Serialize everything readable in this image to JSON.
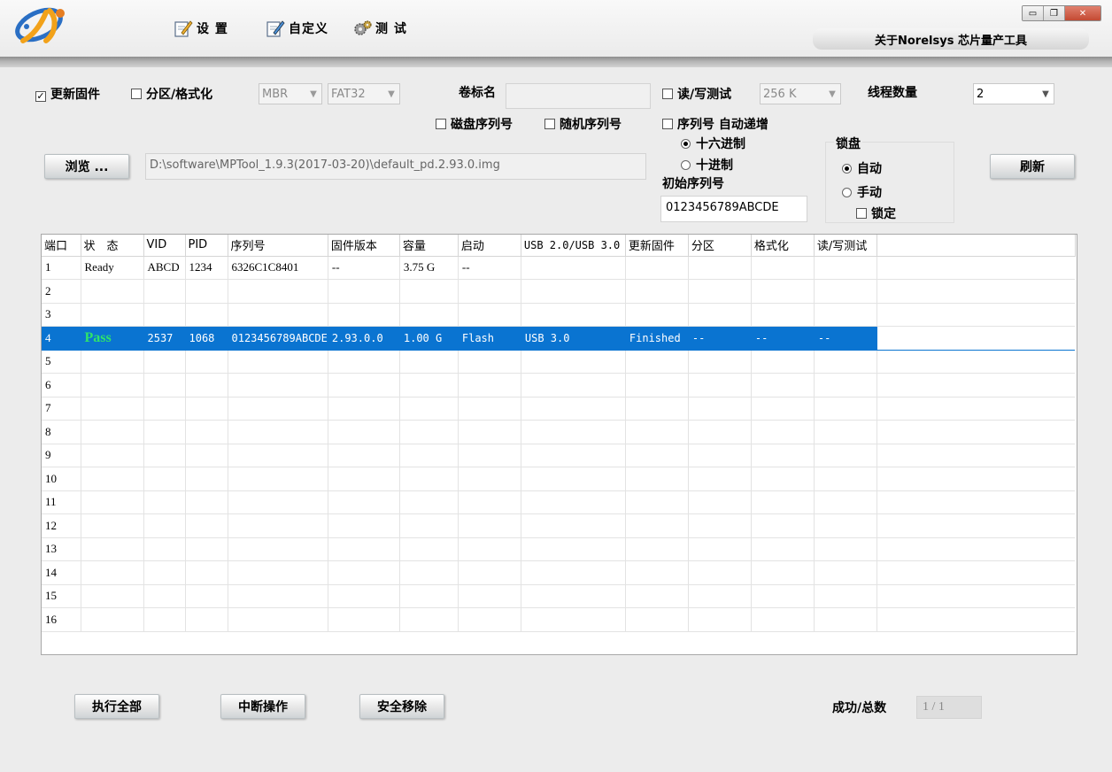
{
  "menu": {
    "settings_label": "设 置",
    "customize_label": "自定义",
    "test_label": "测 试",
    "about_label": "关于Norelsys 芯片量产工具"
  },
  "window_controls": {
    "minimize": "▭",
    "restore": "❐",
    "close": "✕"
  },
  "options": {
    "update_fw": {
      "label": "更新固件",
      "checked": true,
      "mark": "✓"
    },
    "partition_format": {
      "label": "分区/格式化",
      "checked": false
    },
    "partition_scheme": "MBR",
    "filesystem": "FAT32",
    "volume_label_caption": "卷标名",
    "volume_label_value": "",
    "rw_test": {
      "label": "读/写测试",
      "checked": false
    },
    "rw_size": "256 K",
    "thread_count_caption": "线程数量",
    "thread_count": "2",
    "disk_serial": {
      "label": "磁盘序列号",
      "checked": false
    },
    "random_serial": {
      "label": "随机序列号",
      "checked": false
    },
    "serial_auto_inc": {
      "label": "序列号 自动递增",
      "checked": false
    },
    "hex": {
      "label": "十六进制",
      "selected": true
    },
    "dec": {
      "label": "十进制",
      "selected": false
    },
    "initial_serial_caption": "初始序列号",
    "initial_serial_value": "0123456789ABCDE",
    "lock_group_caption": "锁盘",
    "lock_auto": {
      "label": "自动",
      "selected": true
    },
    "lock_manual": {
      "label": "手动",
      "selected": false
    },
    "lock_lock": {
      "label": "锁定",
      "checked": false
    },
    "browse_label": "浏览 ...",
    "firmware_path": "D:\\software\\MPTool_1.9.3(2017-03-20)\\default_pd.2.93.0.img",
    "refresh_label": "刷新"
  },
  "grid": {
    "columns": [
      "端口",
      "状　态",
      "VID",
      "PID",
      "序列号",
      "固件版本",
      "容量",
      "启动",
      "USB 2.0/USB 3.0",
      "更新固件",
      "分区",
      "格式化",
      "读/写测试"
    ],
    "rows": [
      [
        "1",
        "Ready",
        "ABCD",
        "1234",
        "6326C1C8401",
        "--",
        "3.75 G",
        "--",
        "",
        "",
        "",
        "",
        ""
      ],
      [
        "2",
        "",
        "",
        "",
        "",
        "",
        "",
        "",
        "",
        "",
        "",
        "",
        ""
      ],
      [
        "3",
        "",
        "",
        "",
        "",
        "",
        "",
        "",
        "",
        "",
        "",
        "",
        ""
      ],
      [
        "4",
        "Pass",
        "2537",
        "1068",
        "0123456789ABCDE",
        "2.93.0.0",
        "1.00 G",
        "Flash",
        "USB 3.0",
        "Finished",
        "--",
        "--",
        "--"
      ],
      [
        "5",
        "",
        "",
        "",
        "",
        "",
        "",
        "",
        "",
        "",
        "",
        "",
        ""
      ],
      [
        "6",
        "",
        "",
        "",
        "",
        "",
        "",
        "",
        "",
        "",
        "",
        "",
        ""
      ],
      [
        "7",
        "",
        "",
        "",
        "",
        "",
        "",
        "",
        "",
        "",
        "",
        "",
        ""
      ],
      [
        "8",
        "",
        "",
        "",
        "",
        "",
        "",
        "",
        "",
        "",
        "",
        "",
        ""
      ],
      [
        "9",
        "",
        "",
        "",
        "",
        "",
        "",
        "",
        "",
        "",
        "",
        "",
        ""
      ],
      [
        "10",
        "",
        "",
        "",
        "",
        "",
        "",
        "",
        "",
        "",
        "",
        "",
        ""
      ],
      [
        "11",
        "",
        "",
        "",
        "",
        "",
        "",
        "",
        "",
        "",
        "",
        "",
        ""
      ],
      [
        "12",
        "",
        "",
        "",
        "",
        "",
        "",
        "",
        "",
        "",
        "",
        "",
        ""
      ],
      [
        "13",
        "",
        "",
        "",
        "",
        "",
        "",
        "",
        "",
        "",
        "",
        "",
        ""
      ],
      [
        "14",
        "",
        "",
        "",
        "",
        "",
        "",
        "",
        "",
        "",
        "",
        "",
        ""
      ],
      [
        "15",
        "",
        "",
        "",
        "",
        "",
        "",
        "",
        "",
        "",
        "",
        "",
        ""
      ],
      [
        "16",
        "",
        "",
        "",
        "",
        "",
        "",
        "",
        "",
        "",
        "",
        "",
        ""
      ]
    ],
    "selected_row": 3,
    "pass_color": "#2fe36a",
    "selection_color": "#0a74d1"
  },
  "footer": {
    "run_all_label": "执行全部",
    "abort_label": "中断操作",
    "safe_remove_label": "安全移除",
    "success_total_caption": "成功/总数",
    "success_total_value": "1 / 1"
  }
}
